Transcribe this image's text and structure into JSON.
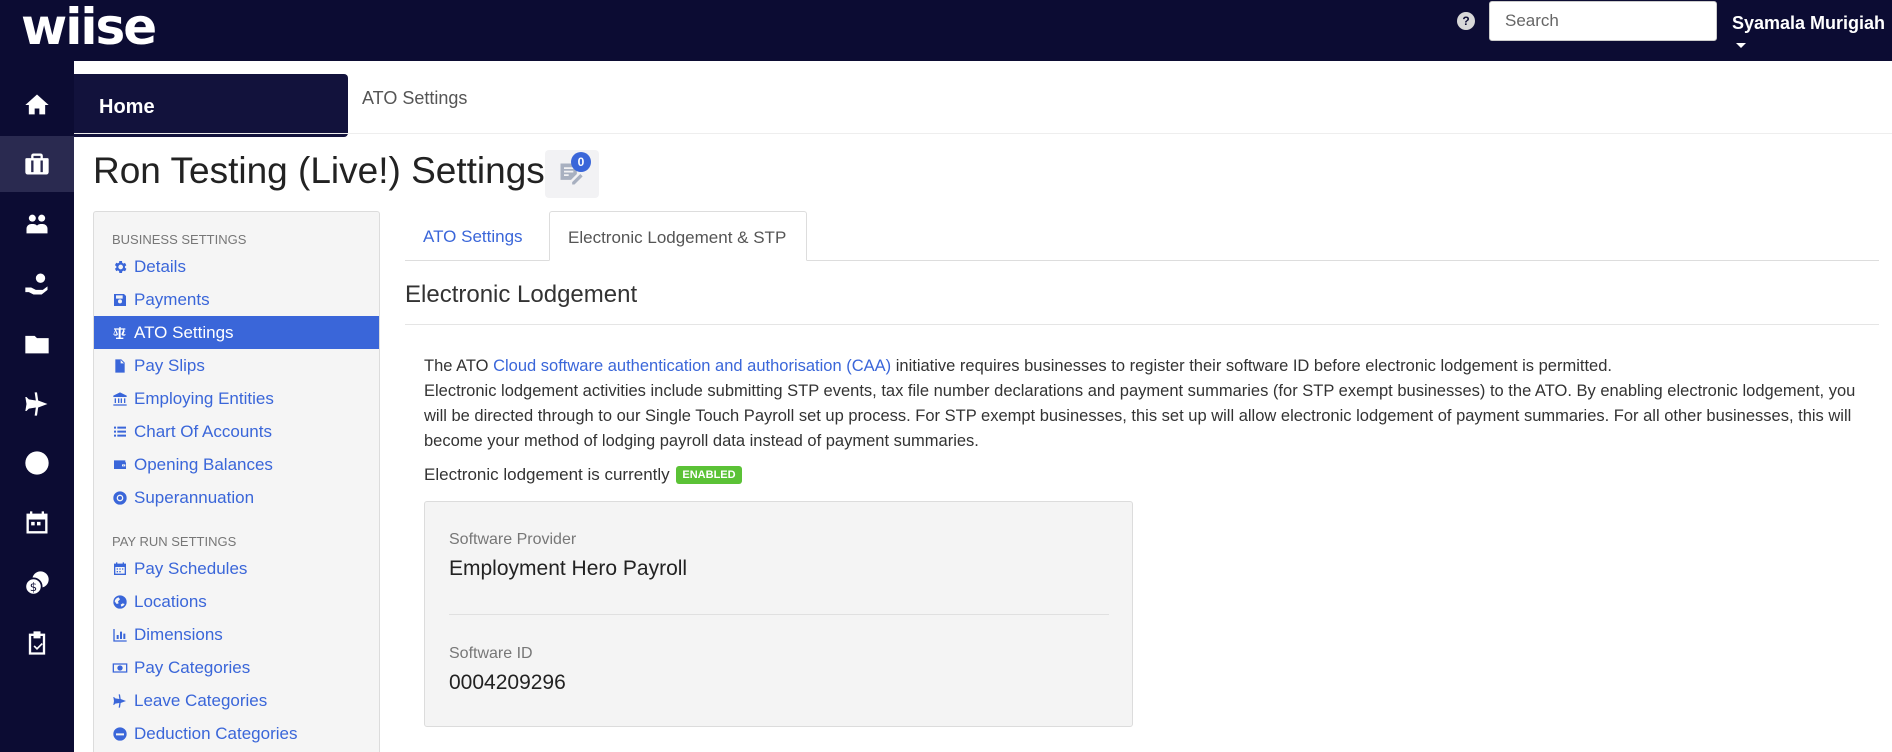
{
  "topbar": {
    "logo": "wiise",
    "help_icon": "?",
    "search_placeholder": "Search",
    "user_name": "Syamala Murigiah"
  },
  "leftnav": {
    "items": [
      {
        "icon": "home-icon"
      },
      {
        "icon": "briefcase-icon"
      },
      {
        "icon": "people-icon"
      },
      {
        "icon": "hand-money-icon"
      },
      {
        "icon": "folder-icon"
      },
      {
        "icon": "plane-icon"
      },
      {
        "icon": "clock-icon"
      },
      {
        "icon": "calendar-icon"
      },
      {
        "icon": "coins-icon"
      },
      {
        "icon": "clipboard-check-icon"
      }
    ],
    "tooltip": "Home"
  },
  "breadcrumb": "ATO Settings",
  "page_title": "Ron Testing (Live!) Settings",
  "notification_count": "0",
  "sidebar": {
    "business_header": "BUSINESS SETTINGS",
    "business_items": [
      {
        "label": "Details",
        "icon": "gear-icon"
      },
      {
        "label": "Payments",
        "icon": "save-icon"
      },
      {
        "label": "ATO Settings",
        "icon": "balance-scale-icon",
        "active": true
      },
      {
        "label": "Pay Slips",
        "icon": "file-icon"
      },
      {
        "label": "Employing Entities",
        "icon": "bank-icon"
      },
      {
        "label": "Chart Of Accounts",
        "icon": "list-icon"
      },
      {
        "label": "Opening Balances",
        "icon": "wallet-icon"
      },
      {
        "label": "Superannuation",
        "icon": "lifebuoy-icon"
      }
    ],
    "payrun_header": "PAY RUN SETTINGS",
    "payrun_items": [
      {
        "label": "Pay Schedules",
        "icon": "calendar-icon"
      },
      {
        "label": "Locations",
        "icon": "globe-icon"
      },
      {
        "label": "Dimensions",
        "icon": "bar-chart-icon"
      },
      {
        "label": "Pay Categories",
        "icon": "money-icon"
      },
      {
        "label": "Leave Categories",
        "icon": "plane-icon"
      },
      {
        "label": "Deduction Categories",
        "icon": "minus-circle-icon"
      }
    ]
  },
  "tabs": [
    {
      "label": "ATO Settings"
    },
    {
      "label": "Electronic Lodgement & STP",
      "active": true
    }
  ],
  "section": {
    "title": "Electronic Lodgement",
    "intro_prefix": "The ATO ",
    "intro_link": "Cloud software authentication and authorisation (CAA)",
    "intro_suffix": " initiative requires businesses to register their software ID before electronic lodgement is permitted.",
    "body": "Electronic lodgement activities include submitting STP events, tax file number declarations and payment summaries (for STP exempt businesses) to the ATO. By enabling electronic lodgement, you will be directed through to our Single Touch Payroll set up process. For STP exempt businesses, this set up will allow electronic lodgement of payment summaries. For all other businesses, this will become your method of lodging payroll data instead of payment summaries.",
    "status_text": "Electronic lodgement is currently",
    "status_badge": "ENABLED",
    "status_color": "#5bc236"
  },
  "card": {
    "provider_label": "Software Provider",
    "provider_value": "Employment Hero Payroll",
    "id_label": "Software ID",
    "id_value": "0004209296"
  },
  "colors": {
    "nav_bg": "#0c0c33",
    "accent": "#3a66d9"
  }
}
